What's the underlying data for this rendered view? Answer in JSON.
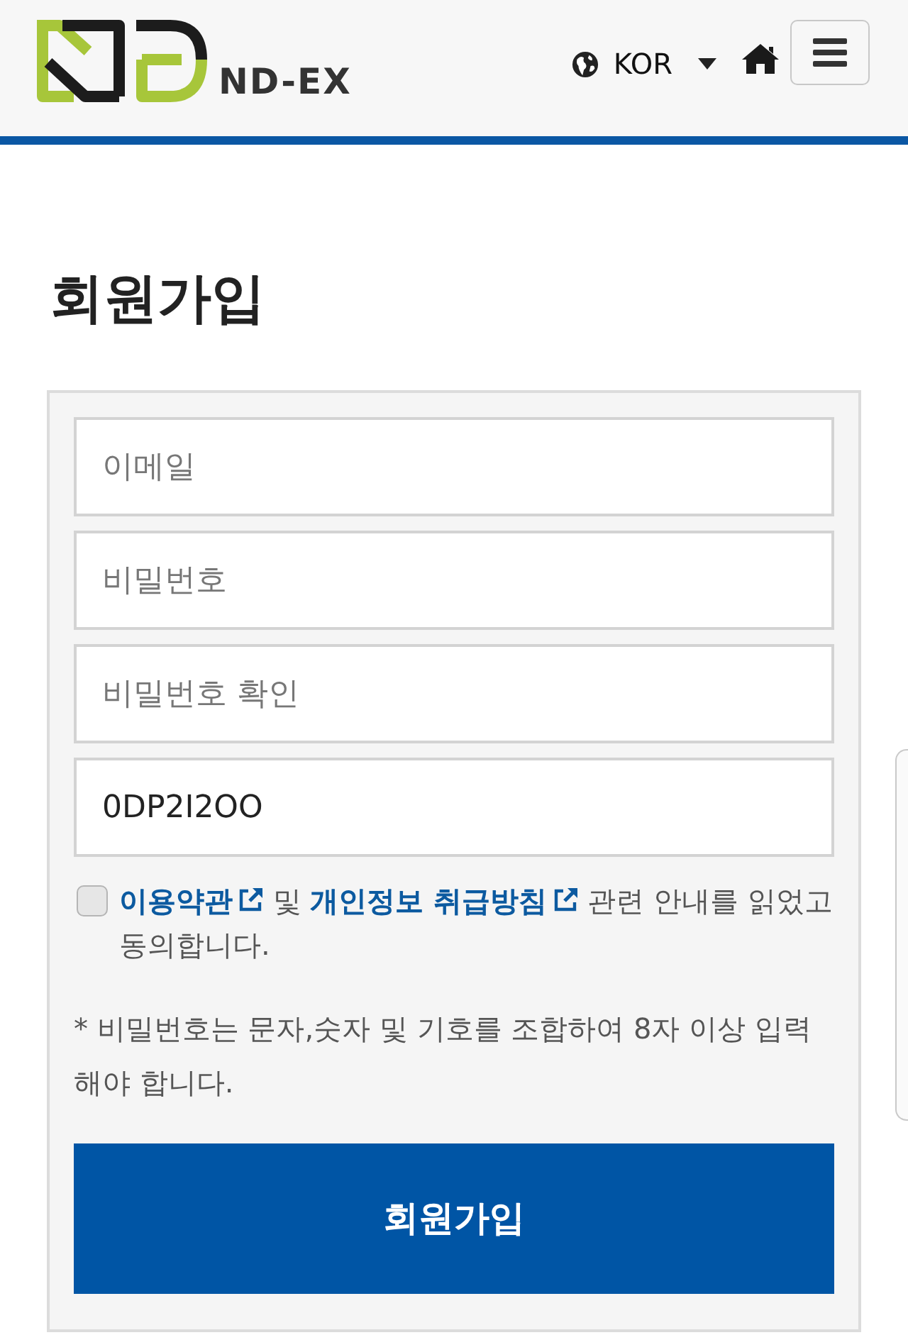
{
  "header": {
    "brand": "ND-EX",
    "language": {
      "label": "KOR"
    }
  },
  "page_title": "회원가입",
  "form": {
    "fields": [
      {
        "placeholder": "이메일"
      },
      {
        "placeholder": "비밀번호"
      },
      {
        "placeholder": "비밀번호 확인"
      },
      {
        "value": "0DP2I2OO"
      }
    ],
    "agreement": {
      "checked": false,
      "parts": [
        {
          "kind": "link",
          "text": "이용약관"
        },
        {
          "kind": "text",
          "text": "및"
        },
        {
          "kind": "link",
          "text": "개인정보 취급방침"
        },
        {
          "kind": "text",
          "text": "관련 안내를 읽었고 동의합니다."
        }
      ]
    },
    "note": "* 비밀번호는 문자,숫자 및 기호를 조합하여 8자 이상 입력해야 합니다.",
    "submit": {
      "label": "회원가입"
    }
  }
}
